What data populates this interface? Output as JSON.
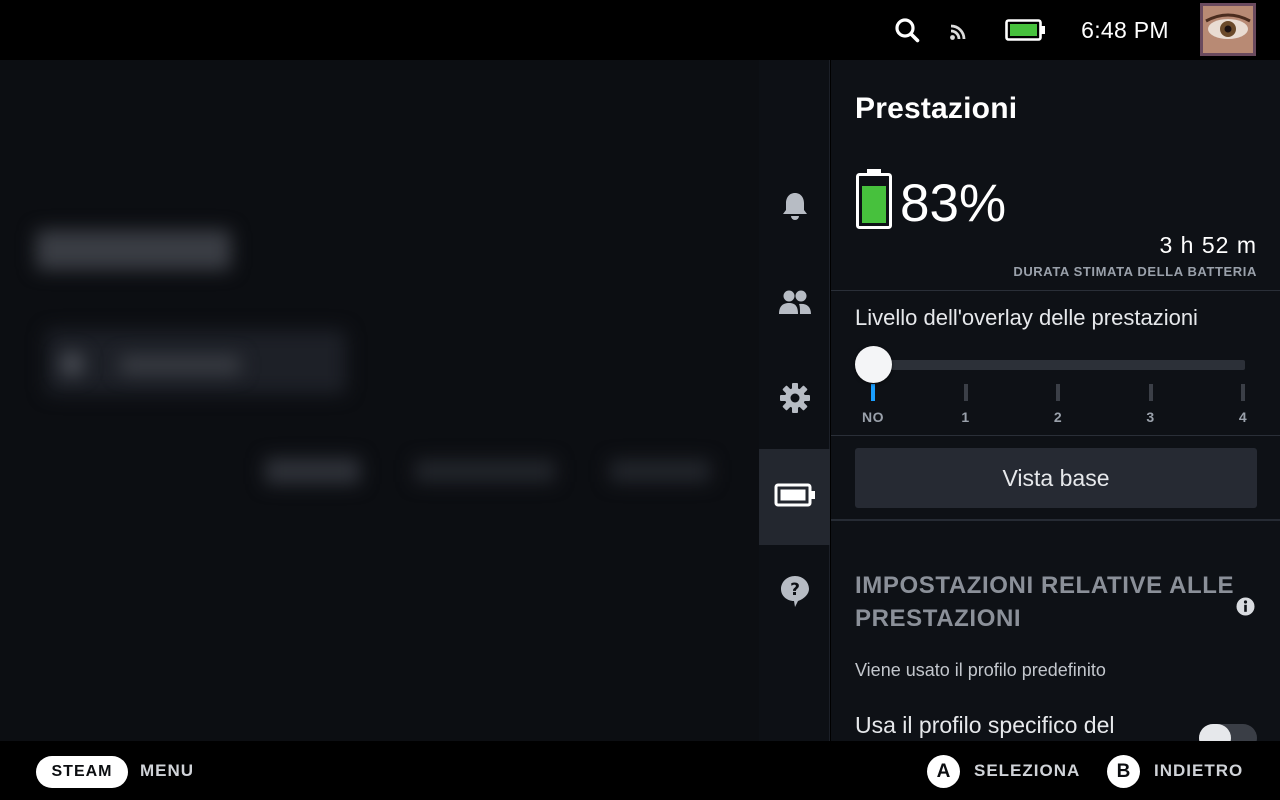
{
  "status_bar": {
    "time": "6:48 PM",
    "icons": [
      "search-icon",
      "cast-icon",
      "battery-icon"
    ],
    "avatar": "avatar-eye"
  },
  "rail": {
    "items": [
      {
        "icon": "bell-icon",
        "active": false
      },
      {
        "icon": "friends-icon",
        "active": false
      },
      {
        "icon": "gear-icon",
        "active": false
      },
      {
        "icon": "battery-icon",
        "active": true
      },
      {
        "icon": "help-icon",
        "active": false
      }
    ]
  },
  "panel": {
    "title": "Prestazioni",
    "battery": {
      "percent": "83%",
      "level": 0.83,
      "remaining": "3 h 52 m",
      "remaining_label": "DURATA STIMATA DELLA BATTERIA",
      "color": "#47c13d"
    },
    "overlay": {
      "label": "Livello dell'overlay delle prestazioni",
      "ticks": [
        "NO",
        "1",
        "2",
        "3",
        "4"
      ],
      "selected_index": 0,
      "accent": "#1a9fff"
    },
    "basic_view_button": "Vista base",
    "settings": {
      "title": "IMPOSTAZIONI RELATIVE ALLE PRESTAZIONI",
      "profile_note": "Viene usato il profilo predefinito",
      "game_profile_label": "Usa il profilo specifico del",
      "game_profile_enabled": false
    }
  },
  "bottom_bar": {
    "steam_label": "STEAM",
    "menu_label": "MENU",
    "a_button": "A",
    "a_label": "SELEZIONA",
    "b_button": "B",
    "b_label": "INDIETRO"
  }
}
